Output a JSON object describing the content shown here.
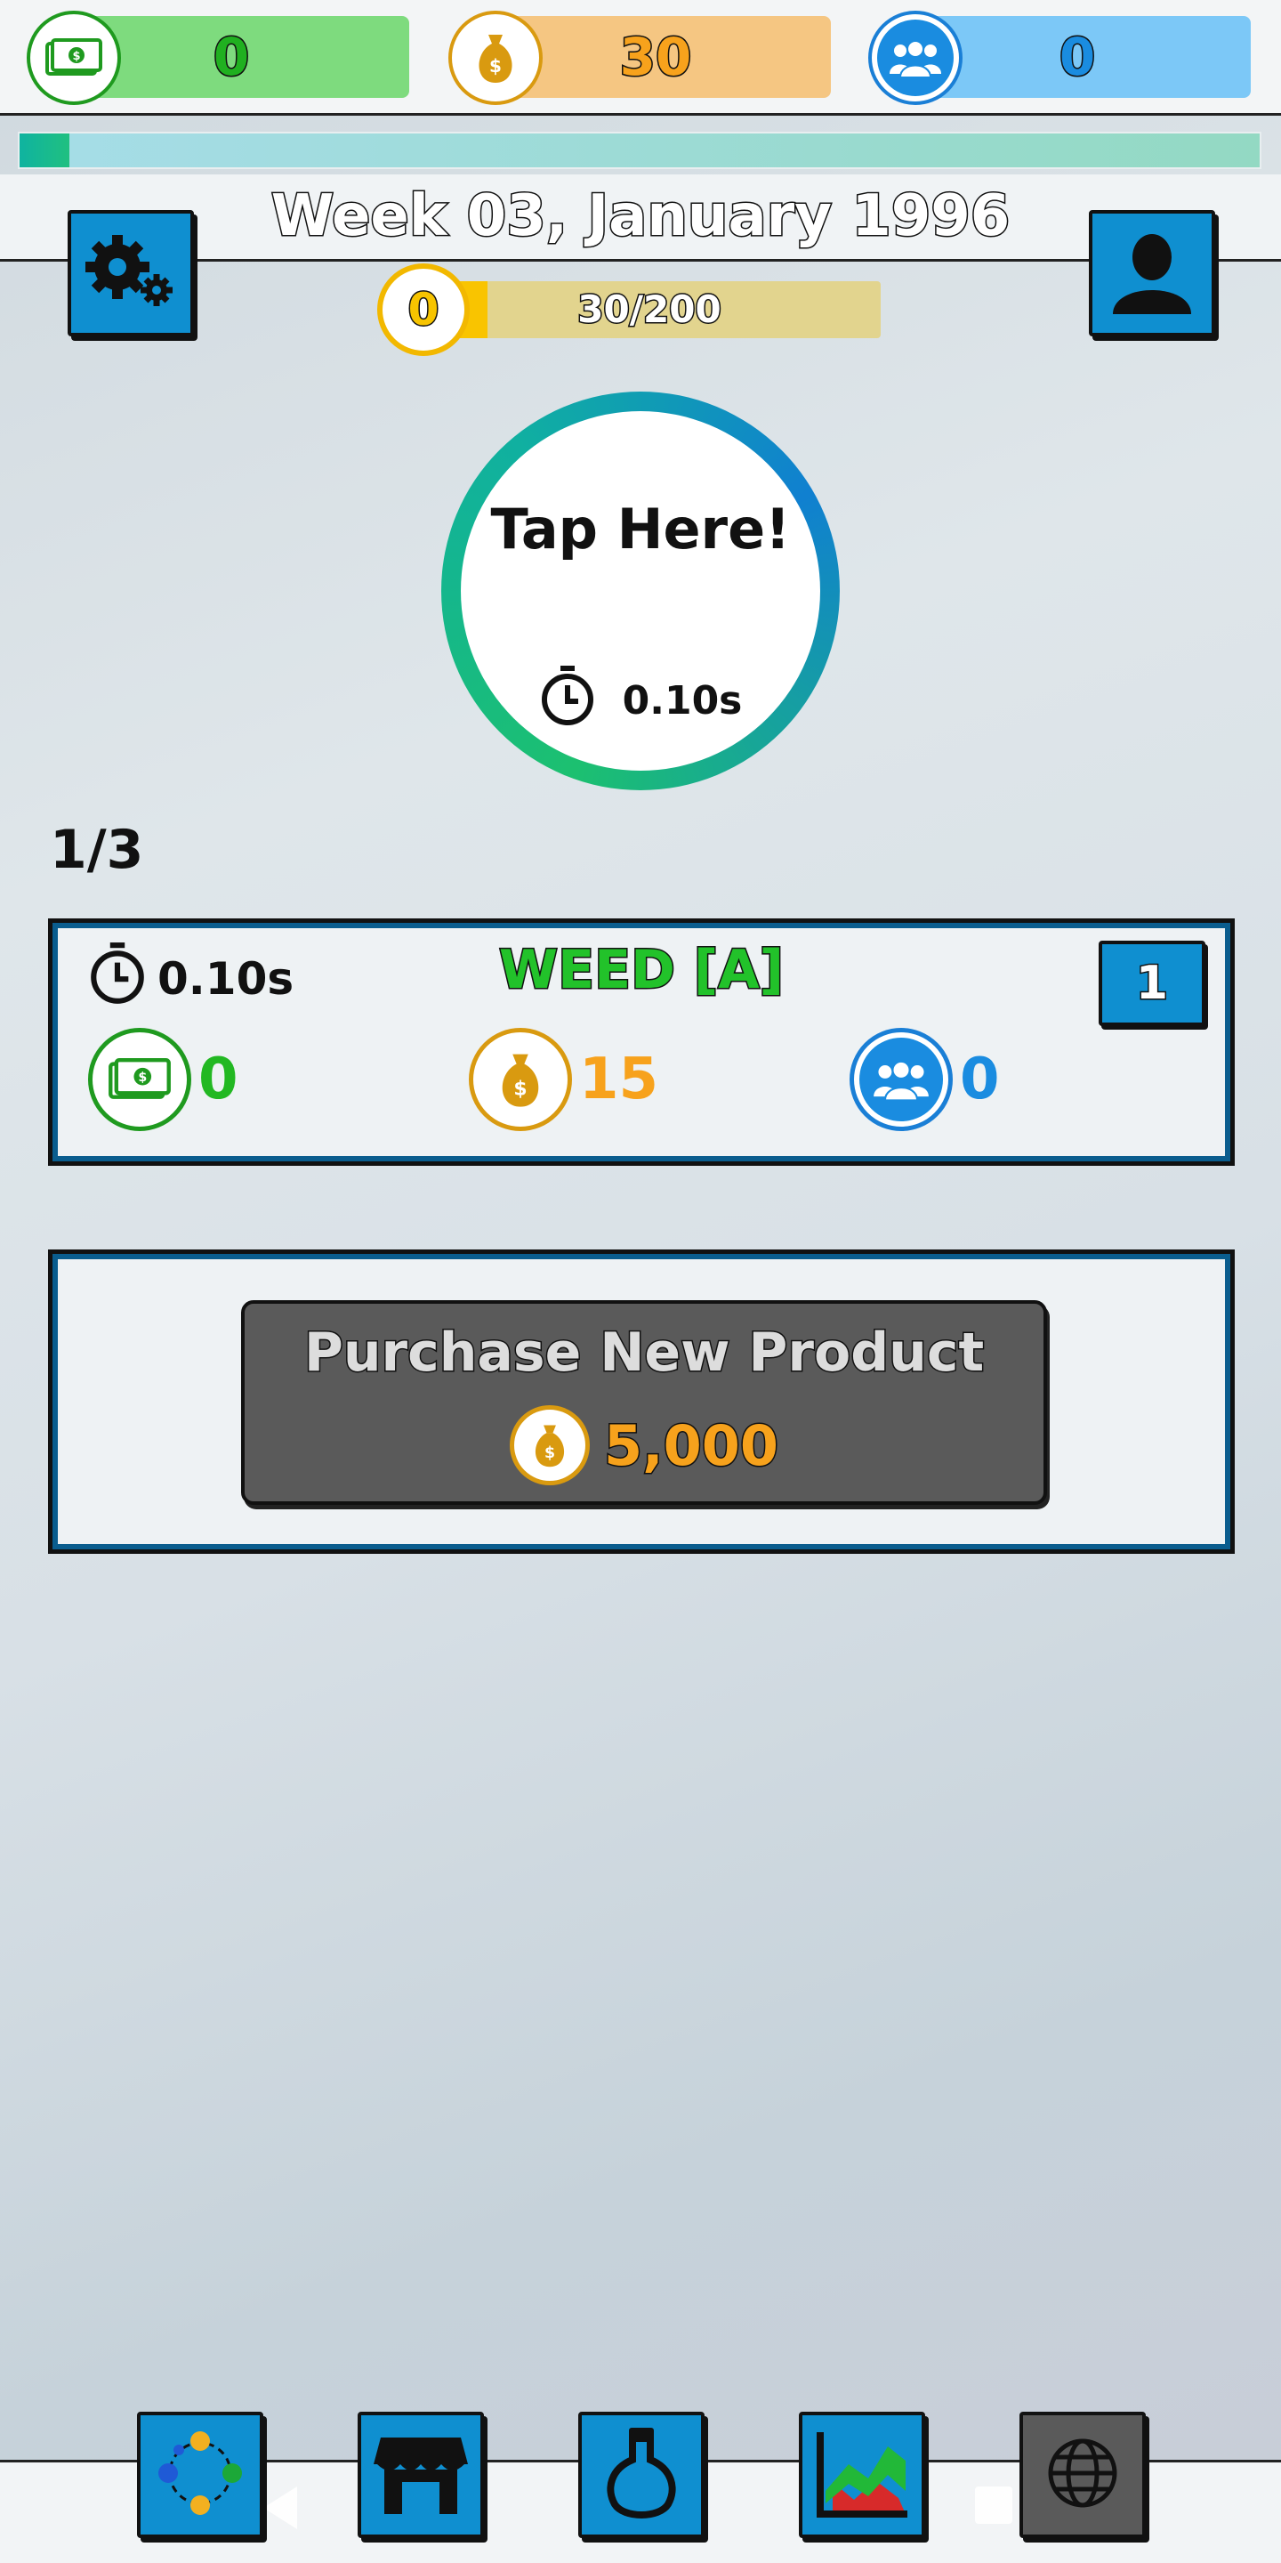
{
  "resources": {
    "cash": {
      "value": "0",
      "icon": "cash-icon",
      "color": "#7edb7e",
      "accent": "#1f9a1f"
    },
    "money_bag": {
      "value": "30",
      "icon": "money-bag-icon",
      "color": "#f5c682",
      "accent": "#d99a10"
    },
    "followers": {
      "value": "0",
      "icon": "people-icon",
      "color": "#7cc8f7",
      "accent": "#1a7fd6"
    }
  },
  "week_progress": 0.04,
  "header": {
    "week_title": "Week 03, January 1996",
    "settings_icon": "gears-icon",
    "profile_icon": "person-icon"
  },
  "level": {
    "badge": "0",
    "progress_text": "30/200",
    "progress": 0.15
  },
  "tap": {
    "label": "Tap Here!",
    "timer": "0.10s"
  },
  "page_count": "1/3",
  "product": {
    "timer": "0.10s",
    "title": "WEED [A]",
    "quantity": "1",
    "cash": "0",
    "money_bag": "15",
    "followers": "0",
    "colors": {
      "title": "#22c22a",
      "cash": "#22b822",
      "money_bag": "#f7a21c",
      "followers": "#1a8ce0"
    }
  },
  "purchase": {
    "label": "Purchase New Product",
    "cost": "5,000"
  },
  "bottom_nav": [
    {
      "name": "network-icon"
    },
    {
      "name": "store-icon"
    },
    {
      "name": "flask-icon"
    },
    {
      "name": "chart-icon"
    },
    {
      "name": "globe-icon"
    }
  ]
}
